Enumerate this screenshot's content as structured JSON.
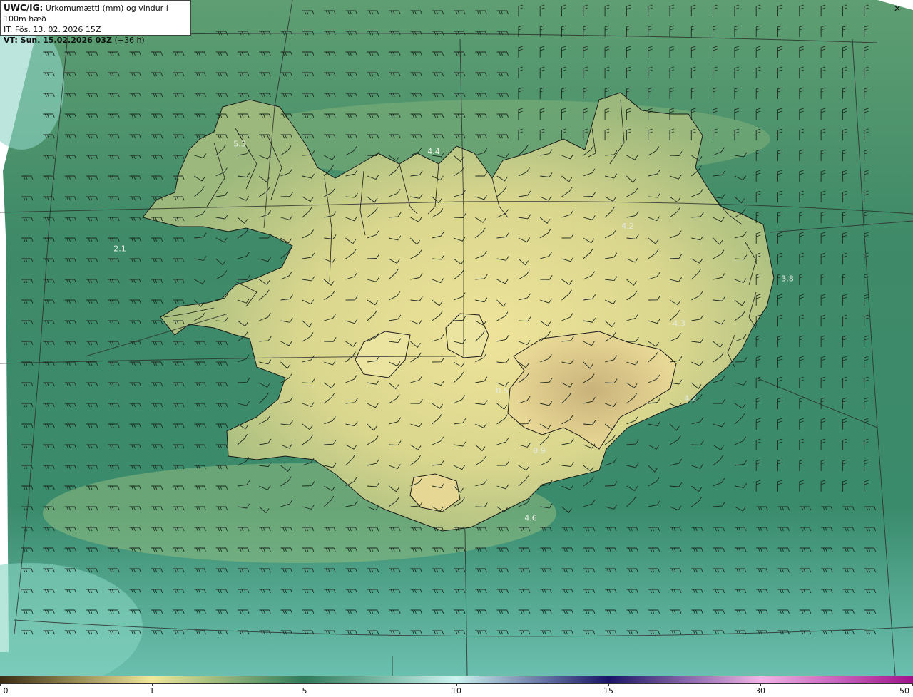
{
  "header": {
    "model": "UWC/IG:",
    "product": "Úrkomumætti (mm) og vindur í 100m hæð",
    "issue_time": "IT: Fös. 13. 02. 2026 15Z",
    "valid_prefix": "VT: Sun. 15.02.2026 03Z",
    "valid_suffix": "(+36 h)"
  },
  "colorbar": {
    "stops": [
      {
        "value": 0,
        "color": "#3b2a12"
      },
      {
        "value": 1,
        "color": "#f1e99a"
      },
      {
        "value": 5,
        "color": "#2f7a5a"
      },
      {
        "value": 10,
        "color": "#cdf4f0"
      },
      {
        "value": 15,
        "color": "#1a1468"
      },
      {
        "value": 30,
        "color": "#f0b4e6"
      },
      {
        "value": 50,
        "color": "#a3118e"
      }
    ],
    "labels": [
      "0",
      "1",
      "5",
      "10",
      "15",
      "30",
      "50"
    ]
  },
  "field_labels": [
    {
      "text": "5.3",
      "lon": -21.3,
      "lat": 66.45
    },
    {
      "text": "4.4",
      "lon": -17.9,
      "lat": 66.4
    },
    {
      "text": "4.2",
      "lon": -14.5,
      "lat": 65.9
    },
    {
      "text": "3.8",
      "lon": -11.7,
      "lat": 65.55
    },
    {
      "text": "4.3",
      "lon": -13.6,
      "lat": 65.25
    },
    {
      "text": "4.2",
      "lon": -13.4,
      "lat": 64.75
    },
    {
      "text": "0.5",
      "lon": -16.7,
      "lat": 64.8
    },
    {
      "text": "0.9",
      "lon": -16.05,
      "lat": 64.4
    },
    {
      "text": "4.6",
      "lon": -16.2,
      "lat": 63.95
    },
    {
      "text": "2.1",
      "lon": -23.4,
      "lat": 65.75
    }
  ],
  "icons": {
    "toggle": "x-corner-icon"
  }
}
